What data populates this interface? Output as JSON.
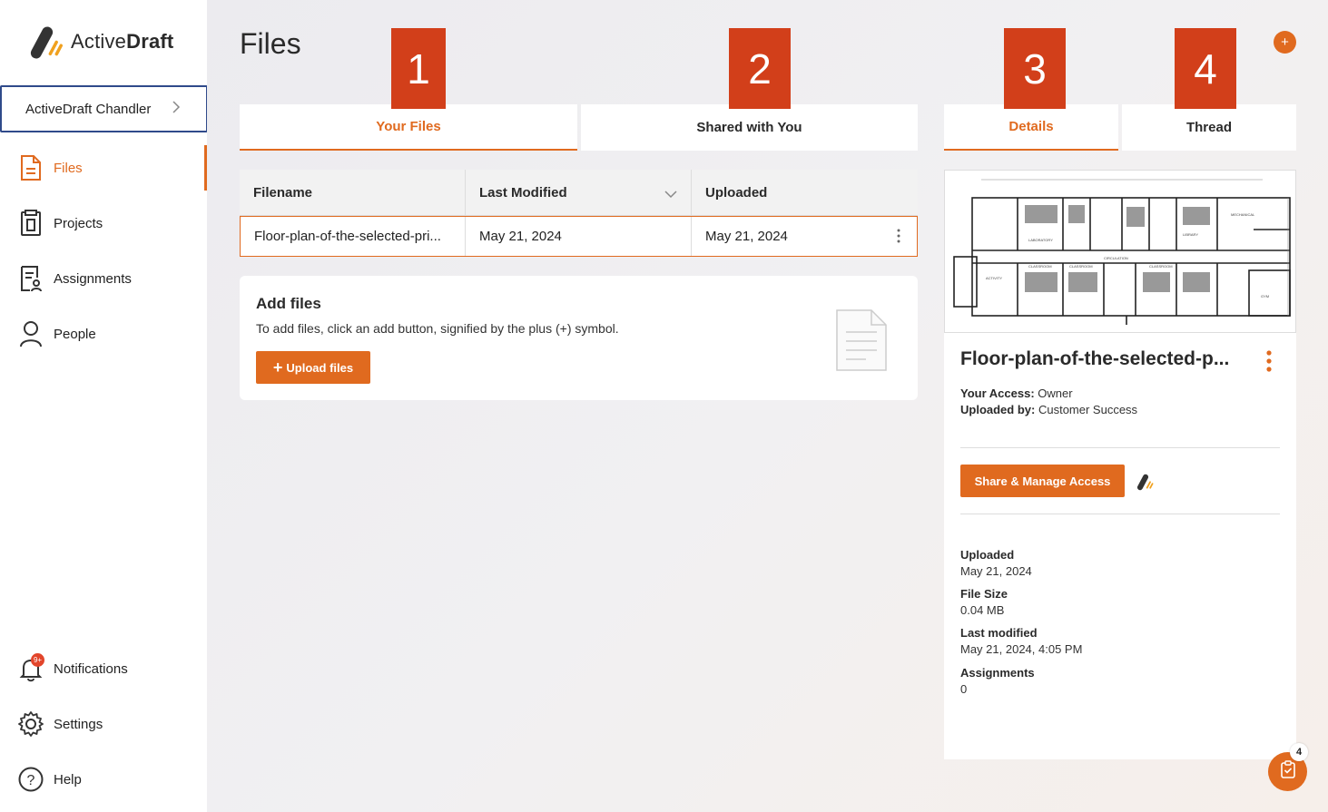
{
  "brand": {
    "name_regular": "Active",
    "name_bold": "Draft"
  },
  "org_selector": {
    "label": "ActiveDraft Chandler"
  },
  "nav": {
    "items": [
      {
        "label": "Files",
        "icon": "file-icon",
        "active": true
      },
      {
        "label": "Projects",
        "icon": "projects-icon"
      },
      {
        "label": "Assignments",
        "icon": "assignment-icon"
      },
      {
        "label": "People",
        "icon": "person-icon"
      }
    ],
    "bottom": [
      {
        "label": "Notifications",
        "icon": "bell-icon",
        "badge": "9+"
      },
      {
        "label": "Settings",
        "icon": "gear-icon"
      },
      {
        "label": "Help",
        "icon": "help-icon"
      }
    ]
  },
  "page": {
    "title": "Files"
  },
  "tabs": {
    "left": [
      {
        "label": "Your Files",
        "active": true
      },
      {
        "label": "Shared with You"
      }
    ],
    "right": [
      {
        "label": "Details",
        "active": true
      },
      {
        "label": "Thread"
      }
    ]
  },
  "markers": [
    "1",
    "2",
    "3",
    "4"
  ],
  "table": {
    "columns": [
      "Filename",
      "Last Modified",
      "Uploaded"
    ],
    "rows": [
      [
        "Floor-plan-of-the-selected-pri...",
        "May 21, 2024",
        "May 21, 2024"
      ]
    ]
  },
  "add_files": {
    "title": "Add files",
    "description": "To add files, click an add button, signified by the plus (+) symbol.",
    "button": "Upload files"
  },
  "details": {
    "filename": "Floor-plan-of-the-selected-p...",
    "access_label": "Your Access:",
    "access_value": "Owner",
    "uploaded_by_label": "Uploaded by:",
    "uploaded_by_value": "Customer Success",
    "share_button": "Share & Manage Access",
    "props": [
      {
        "label": "Uploaded",
        "value": "May 21, 2024"
      },
      {
        "label": "File Size",
        "value": "0.04 MB"
      },
      {
        "label": "Last modified",
        "value": "May 21, 2024, 4:05 PM"
      },
      {
        "label": "Assignments",
        "value": "0"
      }
    ]
  },
  "fab": {
    "badge": "4"
  },
  "colors": {
    "accent": "#e06a1f",
    "marker": "#d23f1a",
    "selector_border": "#2f4a8a"
  }
}
